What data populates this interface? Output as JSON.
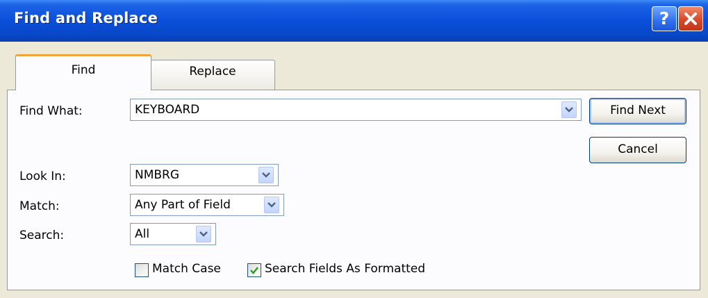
{
  "window": {
    "title": "Find and Replace",
    "help_icon": "help-icon",
    "close_icon": "close-icon"
  },
  "tabs": [
    {
      "label": "Find",
      "active": true
    },
    {
      "label": "Replace",
      "active": false
    }
  ],
  "find_what": {
    "label": "Find What:",
    "value": "KEYBOARD"
  },
  "look_in": {
    "label": "Look In:",
    "value": "NMBRG"
  },
  "match": {
    "label": "Match:",
    "value": "Any Part of Field"
  },
  "search": {
    "label": "Search:",
    "value": "All"
  },
  "options": {
    "match_case": {
      "label": "Match Case",
      "checked": false
    },
    "search_formatted": {
      "label": "Search Fields As Formatted",
      "checked": true
    }
  },
  "buttons": {
    "find_next": "Find Next",
    "cancel": "Cancel"
  },
  "colors": {
    "titlebar": "#0a4fd9",
    "accent_tab": "#f0a43a",
    "check": "#21a121"
  }
}
